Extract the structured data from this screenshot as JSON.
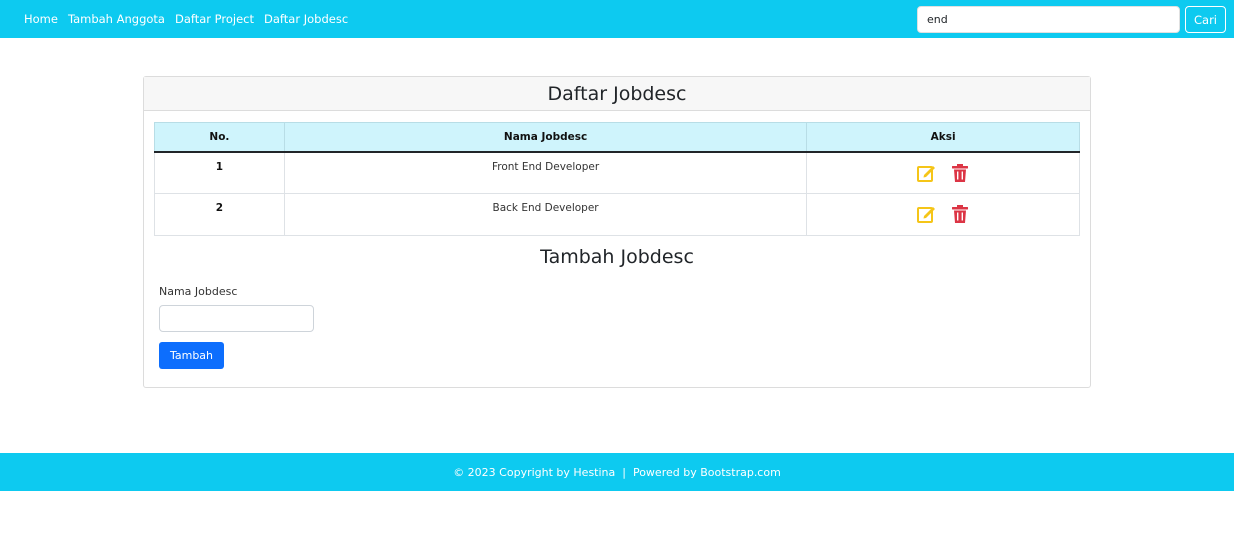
{
  "navbar": {
    "links": [
      "Home",
      "Tambah Anggota",
      "Daftar Project",
      "Daftar Jobdesc"
    ],
    "search_value": "end",
    "search_button": "Cari"
  },
  "card": {
    "title": "Daftar Jobdesc",
    "table": {
      "headers": [
        "No.",
        "Nama Jobdesc",
        "Aksi"
      ],
      "rows": [
        {
          "no": "1",
          "name": "Front End Developer"
        },
        {
          "no": "2",
          "name": "Back End Developer"
        }
      ]
    },
    "form": {
      "title": "Tambah Jobdesc",
      "label": "Nama Jobdesc",
      "input_value": "",
      "submit": "Tambah"
    }
  },
  "footer": {
    "text": "© 2023 Copyright by Hestina  |  Powered by Bootstrap.com"
  },
  "icons": {
    "edit": "edit-icon",
    "delete": "trash-icon"
  },
  "colors": {
    "navbar": "#0dcaf0",
    "table_header": "#cff4fc",
    "primary_button": "#0d6efd",
    "edit_icon": "#f5c518",
    "delete_icon": "#dc3545"
  }
}
